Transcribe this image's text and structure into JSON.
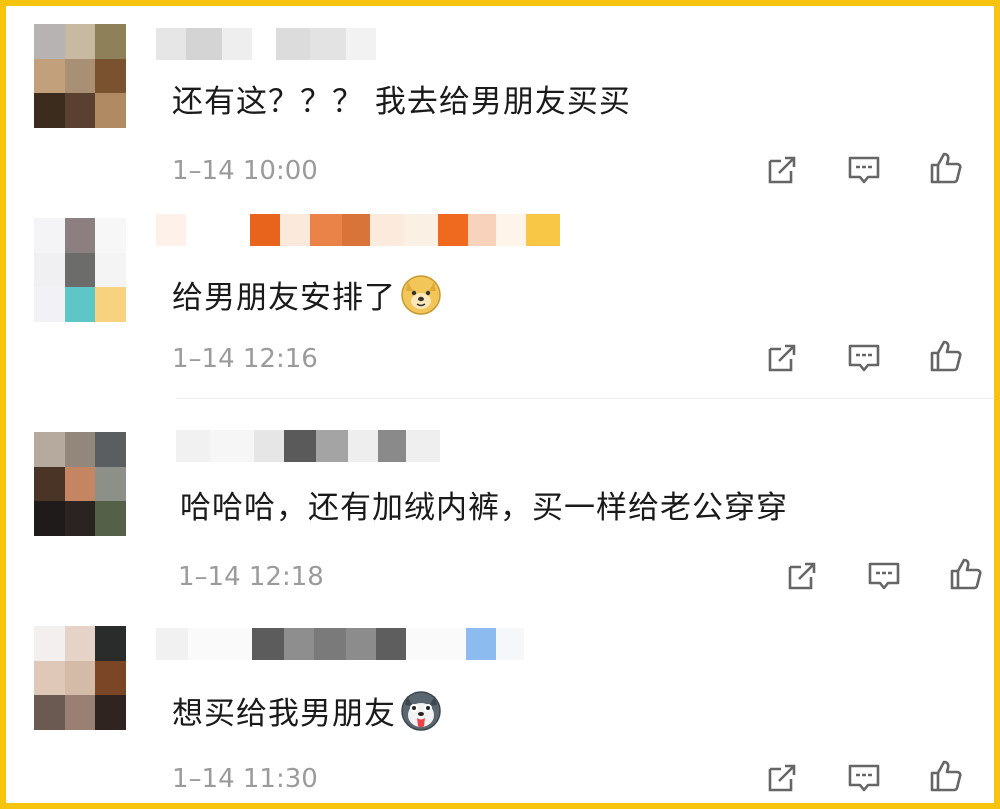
{
  "comments": [
    {
      "text": "还有这？？？ 我去给男朋友买买",
      "time": "1–14 10:00"
    },
    {
      "text": "给男朋友安排了",
      "time": "1–14 12:16",
      "emoji_icon": "doge-icon"
    },
    {
      "text": "哈哈哈，还有加绒内裤，买一样给老公穿穿",
      "time": "1–14 12:18"
    },
    {
      "text": "想买给我男朋友",
      "time": "1–14 11:30",
      "emoji_icon": "husky-tongue-icon"
    }
  ],
  "colors": {
    "border": "#f6c40f",
    "text": "#1a1a1a",
    "time": "#9b9b9b",
    "icon": "#666666"
  },
  "actions": [
    "share-icon",
    "reply-icon",
    "like-icon"
  ]
}
